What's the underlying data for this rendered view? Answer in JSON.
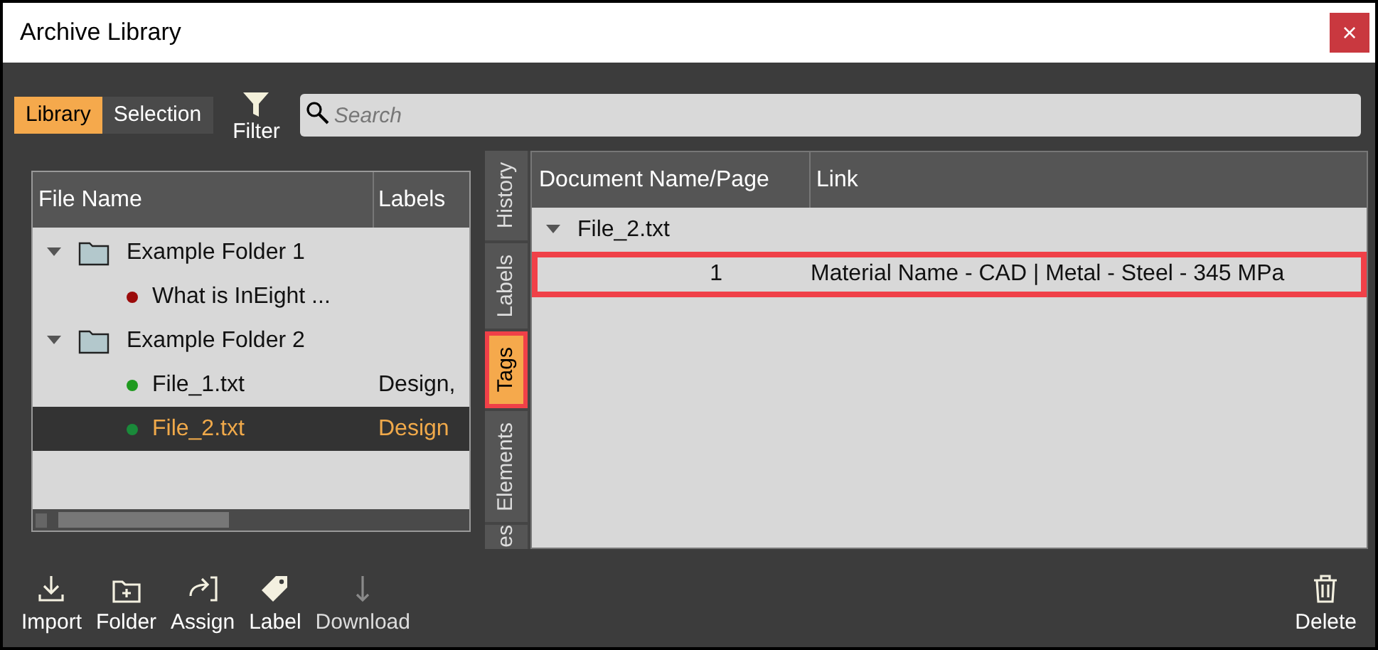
{
  "window": {
    "title": "Archive Library",
    "close": "×"
  },
  "mode_tabs": [
    {
      "label": "Library",
      "selected": true
    },
    {
      "label": "Selection",
      "selected": false
    }
  ],
  "filter": {
    "label": "Filter"
  },
  "search": {
    "placeholder": "Search"
  },
  "file_tree": {
    "columns": [
      "File Name",
      "Labels"
    ],
    "items": [
      {
        "name": "Example Folder 1",
        "expanded": true,
        "selected": false,
        "children": [
          {
            "name": "What is InEight ...",
            "color": "#9b0b0b",
            "selected": false
          }
        ]
      },
      {
        "name": "Example Folder 2",
        "expanded": true,
        "selected": false,
        "children": [
          {
            "name": "File_1.txt",
            "labels": "Design,",
            "color": "#1f9a1f",
            "selected": false
          },
          {
            "name": "File_2.txt",
            "labels": "Design",
            "color": "#1a8a3a",
            "selected": true
          }
        ]
      }
    ]
  },
  "side_tabs": [
    {
      "label": "History",
      "selected": false,
      "highlighted": false
    },
    {
      "label": "Labels",
      "selected": false,
      "highlighted": false
    },
    {
      "label": "Tags",
      "selected": true,
      "highlighted": true
    },
    {
      "label": "Elements",
      "selected": false,
      "highlighted": false
    },
    {
      "label": "es",
      "selected": false,
      "highlighted": false
    }
  ],
  "tags_table": {
    "columns": [
      "Document Name/Page",
      "Link"
    ],
    "groups": [
      {
        "name": "File_2.txt",
        "expanded": true,
        "rows": [
          {
            "page": "1",
            "link": "Material Name - CAD | Metal - Steel - 345 MPa",
            "highlighted": true
          }
        ]
      }
    ]
  },
  "toolbar": [
    {
      "kind": "import",
      "label": "Import",
      "disabled": false
    },
    {
      "kind": "folder",
      "label": "Folder",
      "disabled": false
    },
    {
      "kind": "assign",
      "label": "Assign",
      "disabled": false
    },
    {
      "kind": "label",
      "label": "Label",
      "disabled": false
    },
    {
      "kind": "download",
      "label": "Download",
      "disabled": true
    },
    {
      "kind": "delete",
      "label": "Delete",
      "disabled": false
    }
  ]
}
